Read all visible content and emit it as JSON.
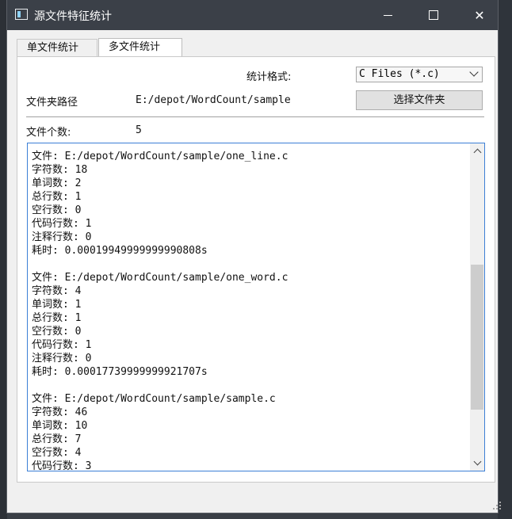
{
  "window": {
    "title": "源文件特征统计"
  },
  "tabs": [
    {
      "label": "单文件统计",
      "active": false
    },
    {
      "label": "多文件统计",
      "active": true
    }
  ],
  "format": {
    "label": "统计格式:",
    "selected": "C Files (*.c)"
  },
  "folder": {
    "label": "文件夹路径",
    "path": "E:/depot/WordCount/sample",
    "button": "选择文件夹"
  },
  "count": {
    "label": "文件个数:",
    "value": "5"
  },
  "output": {
    "text": "文件: E:/depot/WordCount/sample/one_line.c\n字符数: 18\n单词数: 2\n总行数: 1\n空行数: 0\n代码行数: 1\n注释行数: 0\n耗时: 0.00019949999999990808s\n\n文件: E:/depot/WordCount/sample/one_word.c\n字符数: 4\n单词数: 1\n总行数: 1\n空行数: 0\n代码行数: 1\n注释行数: 0\n耗时: 0.00017739999999921707s\n\n文件: E:/depot/WordCount/sample/sample.c\n字符数: 46\n单词数: 10\n总行数: 7\n空行数: 4\n代码行数: 3"
  },
  "colors": {
    "titlebar": "#3b4048",
    "focus_border": "#3c7fd6"
  },
  "icons": {
    "app": "app-window-icon",
    "minimize": "minimize-icon",
    "maximize": "maximize-icon",
    "close": "close-icon"
  }
}
